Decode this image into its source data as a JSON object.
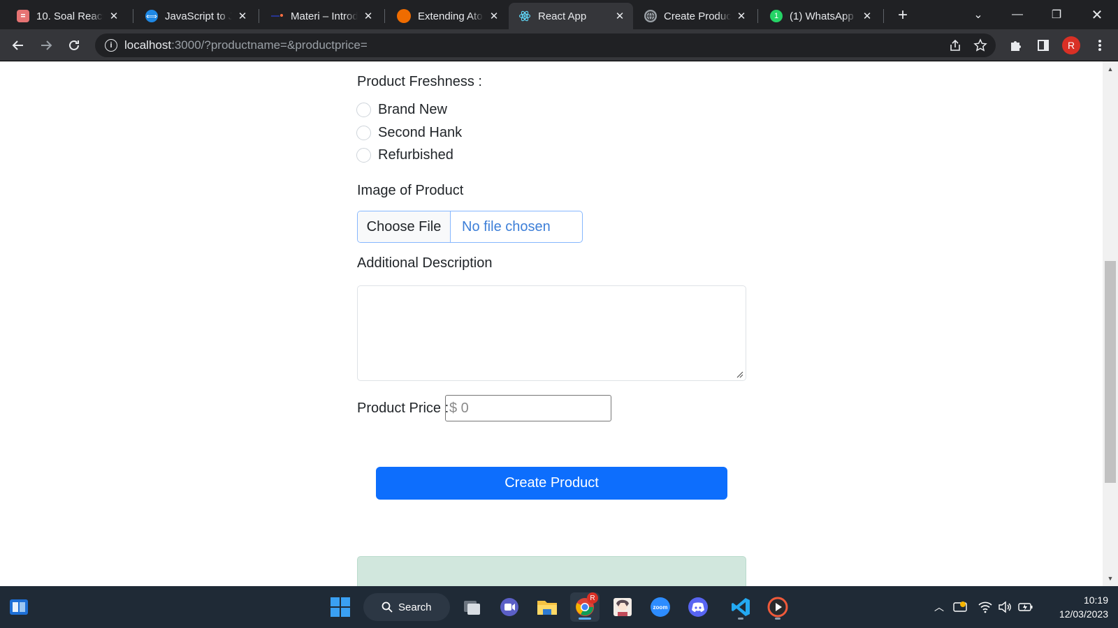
{
  "browser": {
    "tabs": [
      {
        "title": "10. Soal React I",
        "favicon_color": "#e57373",
        "favicon": "document-icon"
      },
      {
        "title": "JavaScript to JS",
        "favicon_color": "#1e88e5",
        "favicon": "transform-icon"
      },
      {
        "title": "Materi – Introd",
        "favicon_color": "#283593",
        "favicon": "page-icon"
      },
      {
        "title": "Extending Ator",
        "favicon_color": "#ef6c00",
        "favicon": "orange-circle-icon"
      },
      {
        "title": "React App",
        "favicon_color": "#61dafb",
        "favicon": "react-icon",
        "active": true
      },
      {
        "title": "Create Product",
        "favicon_color": "#9aa0a6",
        "favicon": "globe-icon"
      },
      {
        "title": "(1) WhatsApp",
        "favicon_color": "#25d366",
        "favicon": "whatsapp-icon",
        "badge": "1"
      }
    ],
    "url_host": "localhost",
    "url_rest": ":3000/?productname=&productprice=",
    "profile_initial": "R"
  },
  "form": {
    "freshness_label": "Product Freshness :",
    "freshness_options": [
      "Brand New",
      "Second Hank",
      "Refurbished"
    ],
    "image_label": "Image of Product",
    "choose_file": "Choose File",
    "no_file": "No file chosen",
    "description_label": "Additional Description",
    "price_label": "Product Price :",
    "price_placeholder": "$ 0",
    "submit_label": "Create Product"
  },
  "taskbar": {
    "search_label": "Search",
    "chrome_badge": "R",
    "zoom_label": "zoom",
    "time": "10:19",
    "date": "12/03/2023"
  },
  "colors": {
    "primary": "#0d6efd",
    "alert_success_bg": "#d1e7dd",
    "focus_border": "#86b7fe"
  }
}
